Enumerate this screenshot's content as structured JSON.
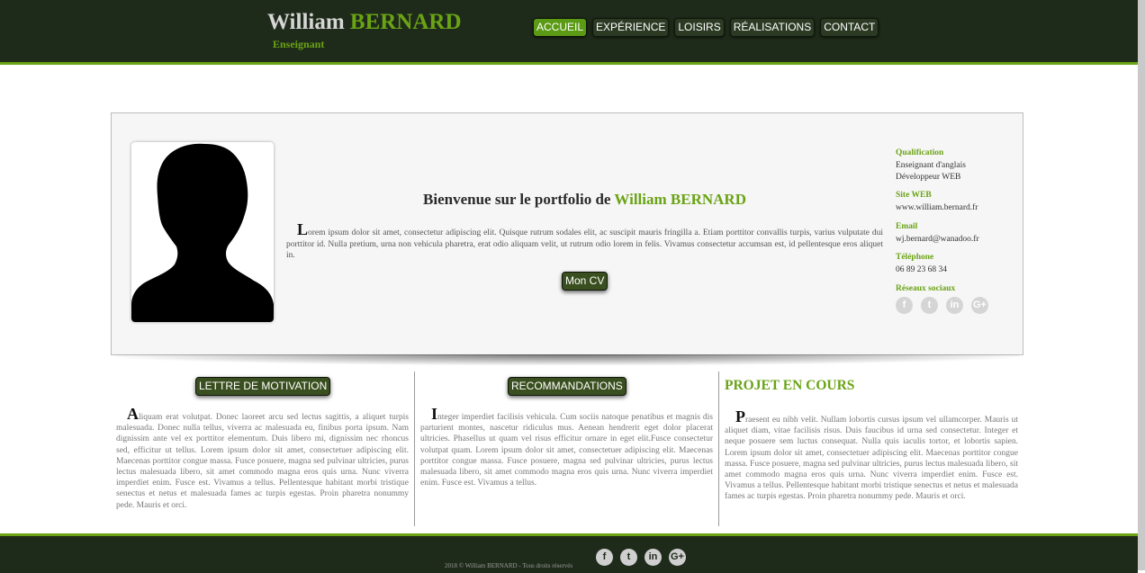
{
  "header": {
    "name_first": "William",
    "name_last": "BERNARD",
    "subtitle": "Enseignant",
    "nav": [
      "ACCUEIL",
      "EXPÉRIENCE",
      "LOISIRS",
      "RÉALISATIONS",
      "CONTACT"
    ],
    "active_nav": "ACCUEIL"
  },
  "profile": {
    "welcome_prefix": "Bienvenue sur le portfolio de",
    "welcome_name": "William BERNARD",
    "intro_dropcap": "L",
    "intro_text": "orem ipsum dolor sit amet, consectetur adipiscing elit. Quisque rutrum sodales elit, ac suscipit mauris fringilla a. Etiam porttitor convallis turpis, varius vulputate dui porttitor id. Nulla pretium, urna non vehicula pharetra, erat odio aliquam velit, ut rutrum odio lorem in felis. Vivamus consectetur accumsan est, id pellentesque eros aliquet in.",
    "cv_button": "Mon CV"
  },
  "info": {
    "qualification_label": "Qualification",
    "qualification_1": "Enseignant d'anglais",
    "qualification_2": "Développeur WEB",
    "site_label": "Site WEB",
    "site_value": "www.william.bernard.fr",
    "email_label": "Email",
    "email_value": "wj.bernard@wanadoo.fr",
    "phone_label": "Téléphone",
    "phone_value": "06 89 23 68 34",
    "social_label": "Réseaux sociaux",
    "social_icons": [
      "facebook-icon",
      "twitter-icon",
      "linkedin-icon",
      "google-plus-icon"
    ]
  },
  "columns": {
    "col1_button": "LETTRE DE MOTIVATION",
    "col1_dropcap": "A",
    "col1_text": "liquam erat volutpat. Donec laoreet arcu sed lectus sagittis, a aliquet turpis malesuada. Donec nulla tellus, viverra ac malesuada eu, finibus porta ipsum. Nam dignissim ante vel ex porttitor elementum. Duis libero mi, dignissim nec rhoncus sed, efficitur ut tellus. Lorem ipsum dolor sit amet, consectetuer adipiscing elit. Maecenas porttitor congue massa. Fusce posuere, magna sed pulvinar ultricies, purus lectus malesuada libero, sit amet commodo magna eros quis urna. Nunc viverra imperdiet enim. Fusce est. Vivamus a tellus. Pellentesque habitant morbi tristique senectus et netus et malesuada fames ac turpis egestas. Proin pharetra nonummy pede. Mauris et orci.",
    "col2_button": "RECOMMANDATIONS",
    "col2_dropcap": "I",
    "col2_text": "nteger imperdiet facilisis vehicula. Cum sociis natoque penatibus et magnis dis parturient montes, nascetur ridiculus mus. Aenean hendrerit eget dolor placerat ultricies. Phasellus ut quam vel risus efficitur ornare in eget elit.Fusce consectetur volutpat quam. Lorem ipsum dolor sit amet, consectetuer adipiscing elit. Maecenas porttitor congue massa. Fusce posuere, magna sed pulvinar ultricies, purus lectus malesuada libero, sit amet commodo magna eros quis urna. Nunc viverra imperdiet enim. Fusce est. Vivamus a tellus.",
    "col3_title": "PROJET EN COURS",
    "col3_dropcap": "P",
    "col3_text": "raesent eu nibh velit. Nullam lobortis cursus ipsum vel ullamcorper. Mauris ut aliquet diam, vitae facilisis risus. Duis faucibus id urna sed consectetur. Integer et neque posuere sem luctus consequat. Nulla quis iaculis tortor, et lobortis sapien. Lorem ipsum dolor sit amet, consectetuer adipiscing elit. Maecenas porttitor congue massa. Fusce posuere, magna sed pulvinar ultricies, purus lectus malesuada libero, sit amet commodo magna eros quis urna. Nunc viverra imperdiet enim. Fusce est. Vivamus a tellus. Pellentesque habitant morbi tristique senectus et netus et malesuada fames ac turpis egestas. Proin pharetra nonummy pede. Mauris et orci."
  },
  "footer": {
    "copyright": "2018 © William BERNARD - Tous droits réservés",
    "social_icons": [
      "facebook-icon",
      "twitter-icon",
      "linkedin-icon",
      "google-plus-icon"
    ]
  },
  "colors": {
    "accent_green": "#6aa315",
    "header_bg": "#1f2b1a",
    "button_bg": "#3a4f1f"
  }
}
